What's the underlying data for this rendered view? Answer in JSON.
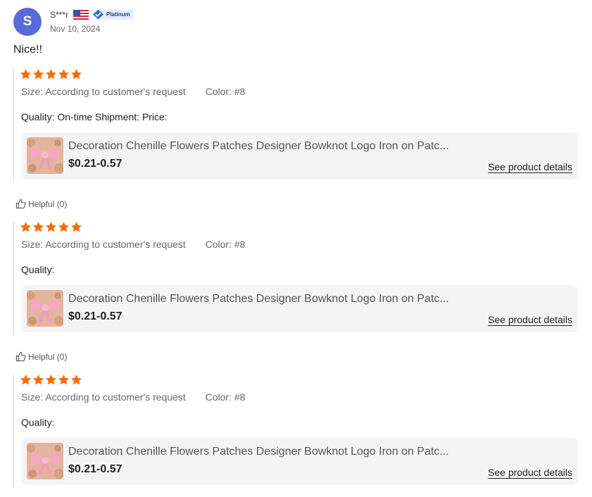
{
  "reviewer": {
    "avatar_letter": "S",
    "name": "S***r",
    "badge": "Platinum",
    "date": "Nov 10, 2024",
    "avatar_color": "#5a6ad8"
  },
  "review_text": "Nice!!",
  "star_color": "#ff6a00",
  "rating": 5,
  "labels": {
    "size": "Size:",
    "color": "Color:",
    "see_details": "See product details"
  },
  "entries": [
    {
      "size_value": "According to customer's request",
      "color_value": "#8",
      "quality_text": "Quality: On-time Shipment: Price:",
      "product_title": "Decoration Chenille Flowers Patches Designer Bowknot Logo Iron on Patc...",
      "price": "$0.21-0.57",
      "helpful": "Helpful (0)"
    },
    {
      "size_value": "According to customer's request",
      "color_value": "#8",
      "quality_text": "Quality:",
      "product_title": "Decoration Chenille Flowers Patches Designer Bowknot Logo Iron on Patc...",
      "price": "$0.21-0.57",
      "helpful": "Helpful (0)"
    },
    {
      "size_value": "According to customer's request",
      "color_value": "#8",
      "quality_text": "Quality:",
      "product_title": "Decoration Chenille Flowers Patches Designer Bowknot Logo Iron on Patc...",
      "price": "$0.21-0.57"
    }
  ]
}
